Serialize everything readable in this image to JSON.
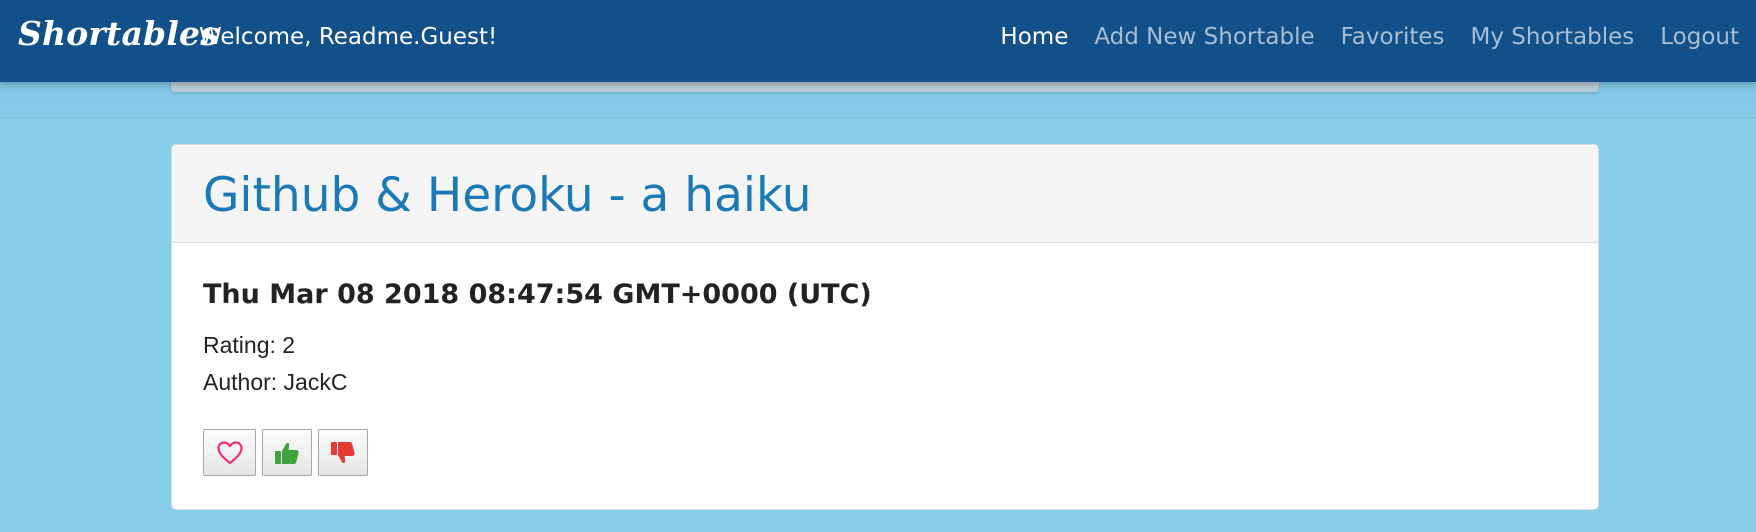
{
  "navbar": {
    "brand": "Shortables",
    "welcome": "Welcome, Readme.Guest!",
    "links": [
      {
        "label": "Home",
        "active": true
      },
      {
        "label": "Add New Shortable",
        "active": false
      },
      {
        "label": "Favorites",
        "active": false
      },
      {
        "label": "My Shortables",
        "active": false
      },
      {
        "label": "Logout",
        "active": false
      }
    ]
  },
  "shortable": {
    "title": "Github & Heroku - a haiku",
    "date": "Thu Mar 08 2018 08:47:54 GMT+0000 (UTC)",
    "rating_text": "Rating: 2",
    "author_text": "Author: JackC"
  },
  "actions": {
    "favorite_icon": "heart-outline-icon",
    "upvote_icon": "thumbs-up-icon",
    "downvote_icon": "thumbs-down-icon"
  },
  "colors": {
    "background": "#87ceeb",
    "navbar": "#12508a",
    "title": "#1b7ab6",
    "heart": "#e8336d",
    "thumbs_up": "#3fa33c",
    "thumbs_down": "#e53935"
  }
}
